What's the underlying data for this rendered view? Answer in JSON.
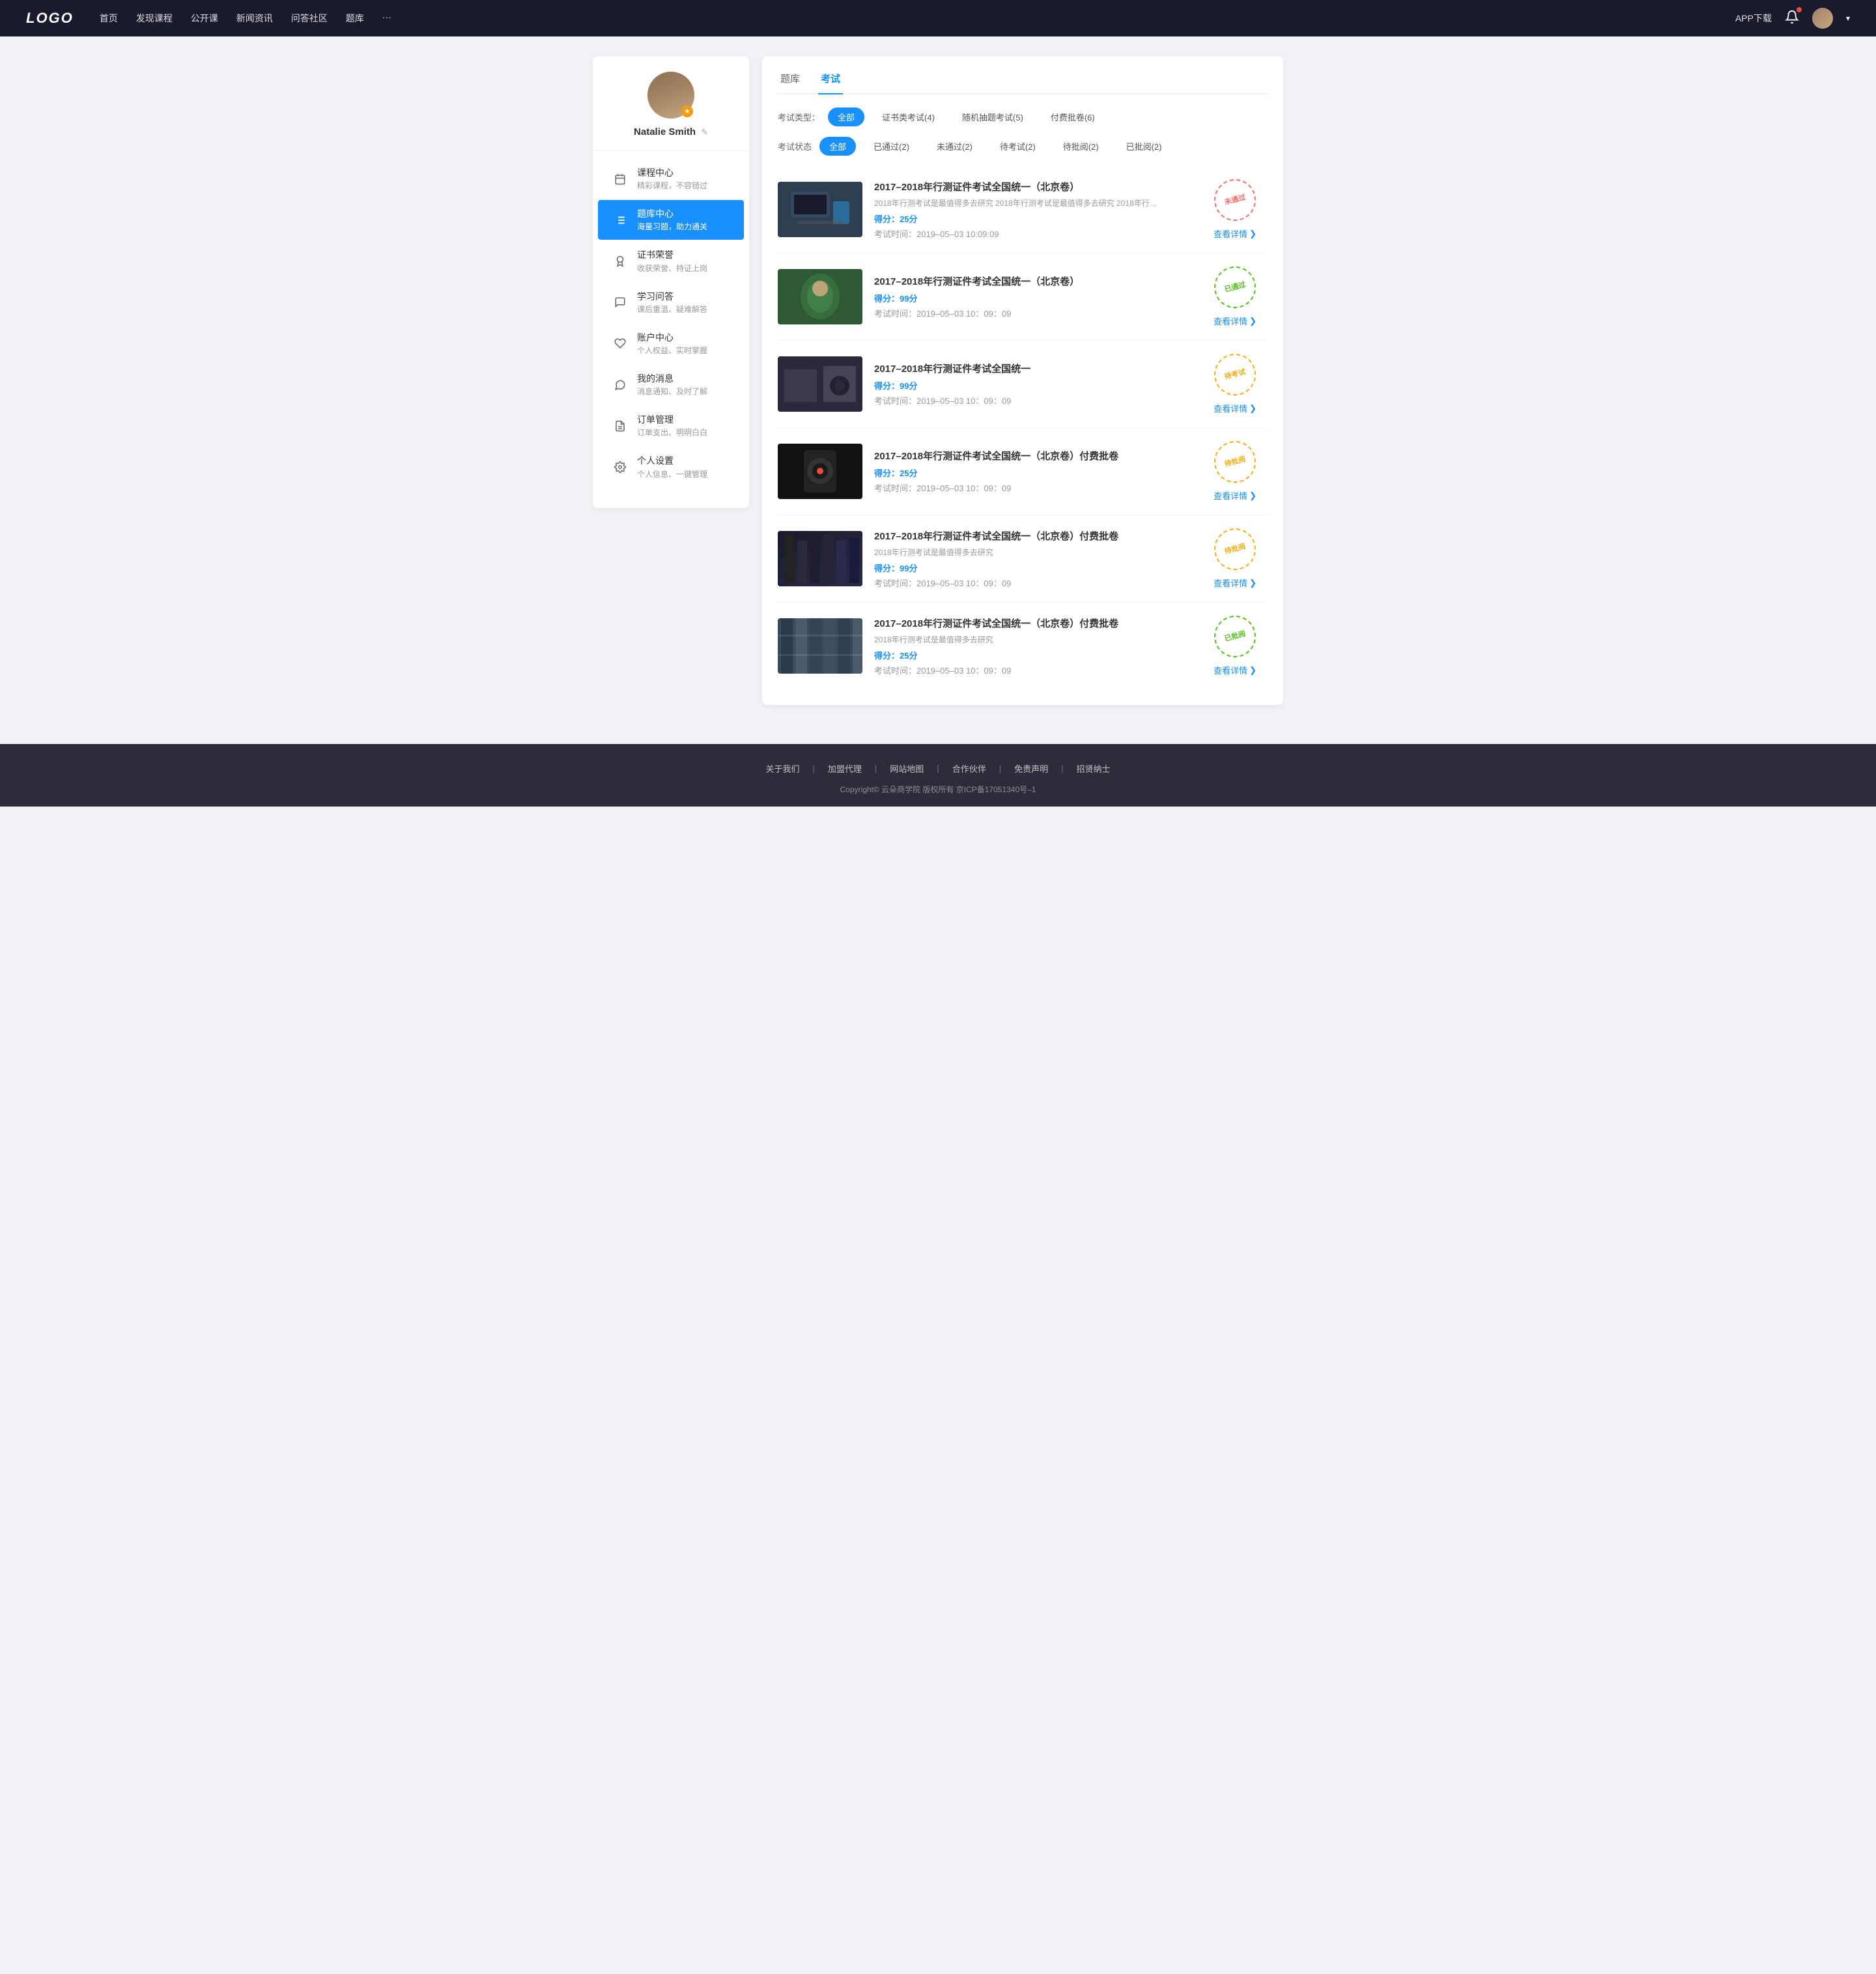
{
  "header": {
    "logo": "LOGO",
    "nav": [
      {
        "label": "首页",
        "key": "home"
      },
      {
        "label": "发现课程",
        "key": "discover"
      },
      {
        "label": "公开课",
        "key": "opencourse"
      },
      {
        "label": "新闻资讯",
        "key": "news"
      },
      {
        "label": "问答社区",
        "key": "qa"
      },
      {
        "label": "题库",
        "key": "questionbank"
      },
      {
        "label": "···",
        "key": "more"
      }
    ],
    "app_btn": "APP下载",
    "user_dropdown_arrow": "▾"
  },
  "sidebar": {
    "profile": {
      "name": "Natalie Smith",
      "edit_icon": "✎"
    },
    "menu": [
      {
        "key": "course-center",
        "icon": "📅",
        "title": "课程中心",
        "sub": "精彩课程，不容错过",
        "active": false
      },
      {
        "key": "question-bank",
        "icon": "☰",
        "title": "题库中心",
        "sub": "海量习题，助力通关",
        "active": true
      },
      {
        "key": "certificate",
        "icon": "🏆",
        "title": "证书荣誉",
        "sub": "收获荣誉、持证上岗",
        "active": false
      },
      {
        "key": "qa",
        "icon": "💬",
        "title": "学习问答",
        "sub": "课后重温、疑难解答",
        "active": false
      },
      {
        "key": "account",
        "icon": "♥",
        "title": "账户中心",
        "sub": "个人权益、实时掌握",
        "active": false
      },
      {
        "key": "messages",
        "icon": "💭",
        "title": "我的消息",
        "sub": "消息通知、及时了解",
        "active": false
      },
      {
        "key": "orders",
        "icon": "📄",
        "title": "订单管理",
        "sub": "订单支出、明明白白",
        "active": false
      },
      {
        "key": "settings",
        "icon": "⚙",
        "title": "个人设置",
        "sub": "个人信息、一键管理",
        "active": false
      }
    ]
  },
  "content": {
    "tabs": [
      {
        "label": "题库",
        "key": "questionbank",
        "active": false
      },
      {
        "label": "考试",
        "key": "exam",
        "active": true
      }
    ],
    "filter_type": {
      "label": "考试类型：",
      "options": [
        {
          "label": "全部",
          "active": true
        },
        {
          "label": "证书类考试(4)",
          "active": false
        },
        {
          "label": "随机抽题考试(5)",
          "active": false
        },
        {
          "label": "付费批卷(6)",
          "active": false
        }
      ]
    },
    "filter_status": {
      "label": "考试状态",
      "options": [
        {
          "label": "全部",
          "active": true
        },
        {
          "label": "已通过(2)",
          "active": false
        },
        {
          "label": "未通过(2)",
          "active": false
        },
        {
          "label": "待考试(2)",
          "active": false
        },
        {
          "label": "待批阅(2)",
          "active": false
        },
        {
          "label": "已批阅(2)",
          "active": false
        }
      ]
    },
    "exam_list": [
      {
        "id": 1,
        "title": "2017–2018年行测证件考试全国统一（北京卷）",
        "desc": "2018年行测考试是最值得多去研究 2018年行测考试是最值得多去研究 2018年行…",
        "score_label": "得分：",
        "score": "25",
        "score_unit": "分",
        "time_label": "考试时间：",
        "time": "2019–05–03  10:09:09",
        "status": "未通过",
        "stamp_type": "failed",
        "detail_label": "查看详情",
        "thumb_class": "thumb-1"
      },
      {
        "id": 2,
        "title": "2017–2018年行测证件考试全国统一（北京卷）",
        "desc": "",
        "score_label": "得分：",
        "score": "99",
        "score_unit": "分",
        "time_label": "考试时间：",
        "time": "2019–05–03  10：09：09",
        "status": "已通过",
        "stamp_type": "passed",
        "detail_label": "查看详情",
        "thumb_class": "thumb-2"
      },
      {
        "id": 3,
        "title": "2017–2018年行测证件考试全国统一",
        "desc": "",
        "score_label": "得分：",
        "score": "99",
        "score_unit": "分",
        "time_label": "考试时间：",
        "time": "2019–05–03  10：09：09",
        "status": "待考试",
        "stamp_type": "pending",
        "detail_label": "查看详情",
        "thumb_class": "thumb-3"
      },
      {
        "id": 4,
        "title": "2017–2018年行测证件考试全国统一（北京卷）付费批卷",
        "desc": "",
        "score_label": "得分：",
        "score": "25",
        "score_unit": "分",
        "time_label": "考试时间：",
        "time": "2019–05–03  10：09：09",
        "status": "待批阅",
        "stamp_type": "review",
        "detail_label": "查看详情",
        "thumb_class": "thumb-4"
      },
      {
        "id": 5,
        "title": "2017–2018年行测证件考试全国统一（北京卷）付费批卷",
        "desc": "2018年行测考试是最值得多去研究",
        "score_label": "得分：",
        "score": "99",
        "score_unit": "分",
        "time_label": "考试时间：",
        "time": "2019–05–03  10：09：09",
        "status": "待批阅",
        "stamp_type": "review",
        "detail_label": "查看详情",
        "thumb_class": "thumb-5"
      },
      {
        "id": 6,
        "title": "2017–2018年行测证件考试全国统一（北京卷）付费批卷",
        "desc": "2018年行测考试是最值得多去研究",
        "score_label": "得分：",
        "score": "25",
        "score_unit": "分",
        "time_label": "考试时间：",
        "time": "2019–05–03  10：09：09",
        "status": "已批阅",
        "stamp_type": "reviewed",
        "detail_label": "查看详情",
        "thumb_class": "thumb-6"
      }
    ]
  },
  "footer": {
    "links": [
      {
        "label": "关于我们"
      },
      {
        "label": "加盟代理"
      },
      {
        "label": "网站地图"
      },
      {
        "label": "合作伙伴"
      },
      {
        "label": "免责声明"
      },
      {
        "label": "招贤纳士"
      }
    ],
    "copyright": "Copyright© 云朵商学院  版权所有    京ICP备17051340号–1"
  }
}
